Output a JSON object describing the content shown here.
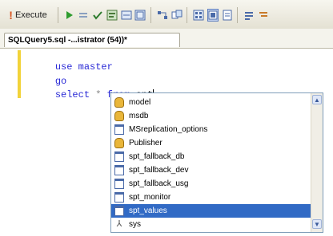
{
  "toolbar": {
    "execute_label": "Execute",
    "icons": [
      "run-icon",
      "stop-icon",
      "parse-icon",
      "display-plan-icon",
      "query-options-icon",
      "results-grid-icon",
      "indent-icon",
      "object-explorer-icon",
      "results-text-icon",
      "results-file-icon",
      "comment-icon",
      "uncomment-icon"
    ]
  },
  "tab": {
    "title": "SQLQuery5.sql -...istrator (54))*"
  },
  "editor": {
    "line1": {
      "keyword": "use",
      "rest": "master"
    },
    "line2": {
      "keyword": "go"
    },
    "line3": {
      "keyword1": "select",
      "star": "*",
      "keyword2": "from",
      "rest": "spt"
    }
  },
  "intellisense": {
    "items": [
      {
        "label": "model",
        "icon": "database"
      },
      {
        "label": "msdb",
        "icon": "database"
      },
      {
        "label": "MSreplication_options",
        "icon": "table"
      },
      {
        "label": "Publisher",
        "icon": "database"
      },
      {
        "label": "spt_fallback_db",
        "icon": "table"
      },
      {
        "label": "spt_fallback_dev",
        "icon": "table"
      },
      {
        "label": "spt_fallback_usg",
        "icon": "table"
      },
      {
        "label": "spt_monitor",
        "icon": "table"
      },
      {
        "label": "spt_values",
        "icon": "table",
        "selected": true
      },
      {
        "label": "sys",
        "icon": "schema"
      }
    ]
  },
  "colors": {
    "selection": "#316ac5",
    "keyword": "#2a2ad6",
    "gutter_change": "#f2d33a"
  }
}
